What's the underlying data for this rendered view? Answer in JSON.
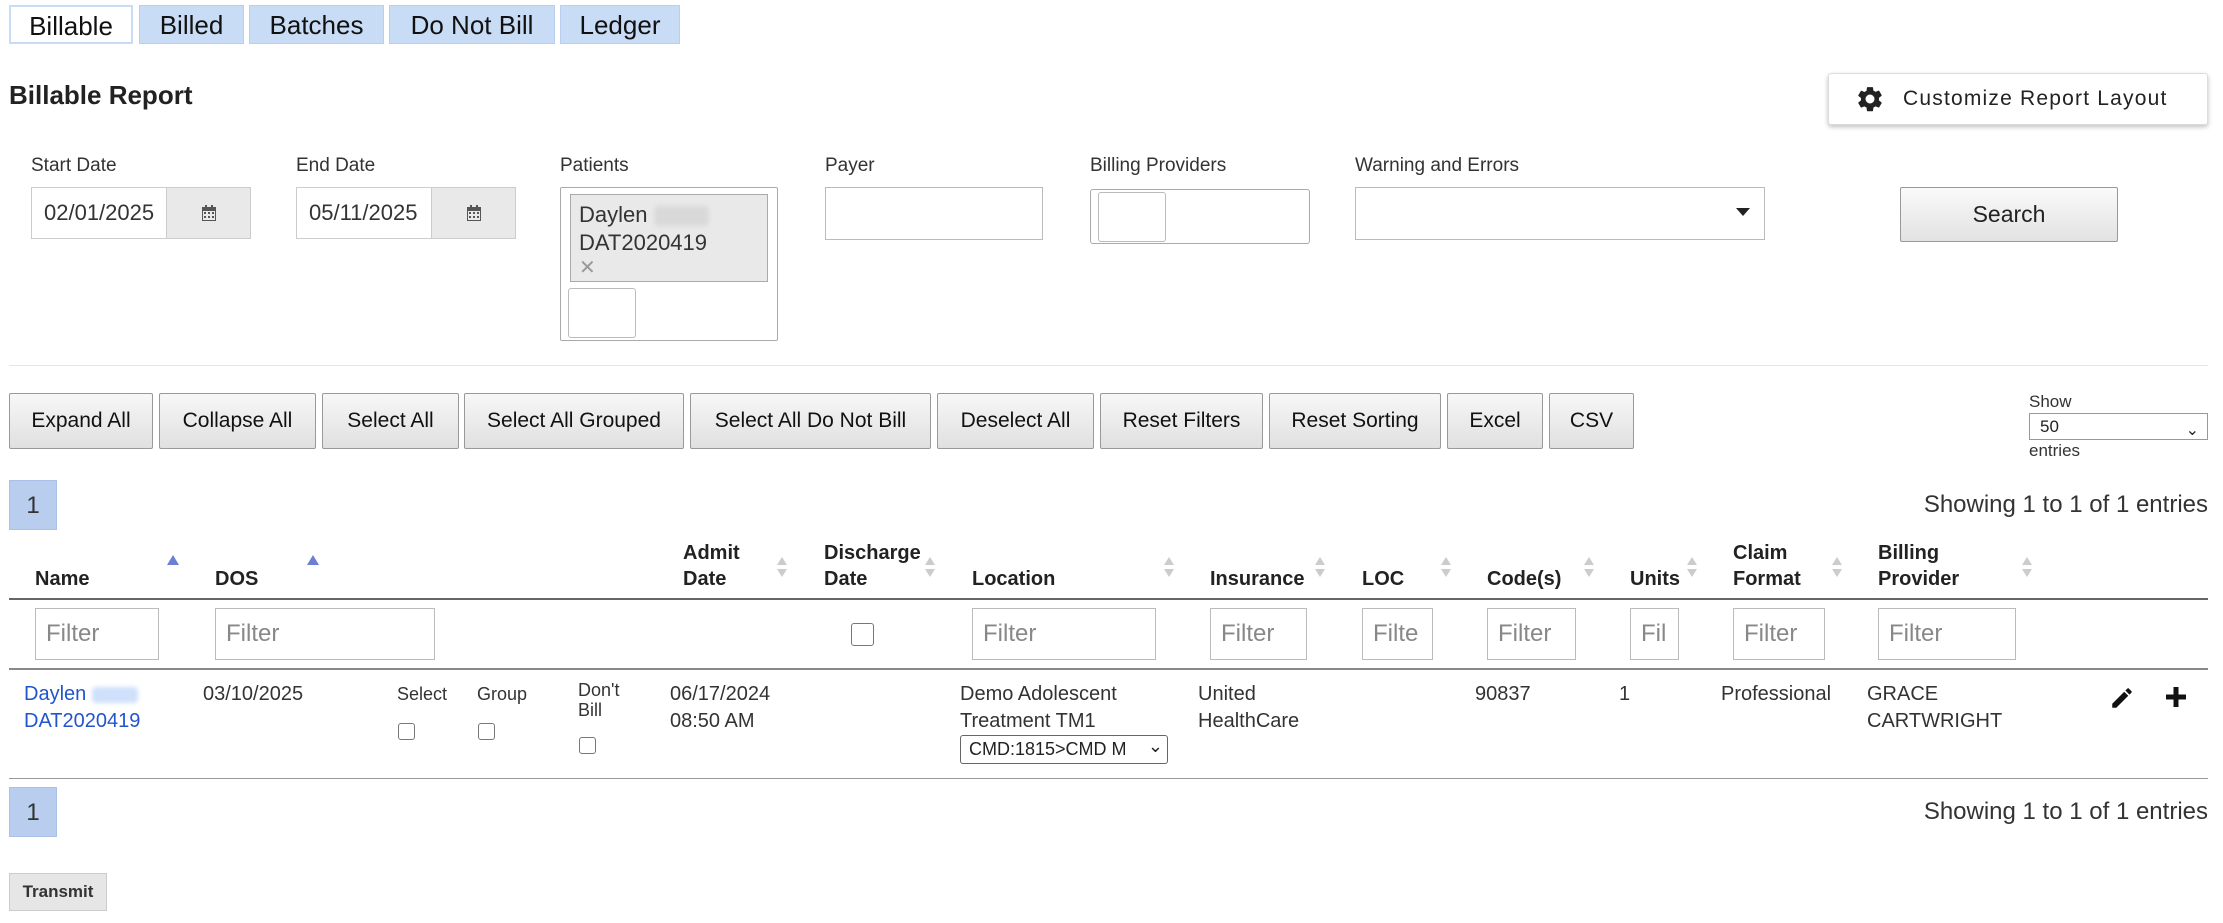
{
  "tabs": [
    {
      "label": "Billable",
      "active": true
    },
    {
      "label": "Billed"
    },
    {
      "label": "Batches"
    },
    {
      "label": "Do Not Bill"
    },
    {
      "label": "Ledger"
    }
  ],
  "page_title": "Billable Report",
  "customize_label": "Customize Report Layout",
  "filters": {
    "start_date_label": "Start Date",
    "start_date_value": "02/01/2025",
    "end_date_label": "End Date",
    "end_date_value": "05/11/2025",
    "patients_label": "Patients",
    "patient_chip_first": "Daylen",
    "patient_chip_id": "DAT2020419",
    "payer_label": "Payer",
    "billing_providers_label": "Billing Providers",
    "warnings_label": "Warning and Errors",
    "search_label": "Search"
  },
  "actions": [
    "Expand All",
    "Collapse All",
    "Select All",
    "Select All Grouped",
    "Select All Do Not Bill",
    "Deselect All",
    "Reset Filters",
    "Reset Sorting",
    "Excel",
    "CSV"
  ],
  "show": {
    "label": "Show",
    "value": "50",
    "suffix": "entries"
  },
  "pagination": {
    "page": "1",
    "info": "Showing 1 to 1 of 1 entries"
  },
  "table": {
    "headers": {
      "name": "Name",
      "dos": "DOS",
      "admit_1": "Admit",
      "admit_2": "Date",
      "discharge_1": "Discharge",
      "discharge_2": "Date",
      "location": "Location",
      "insurance": "Insurance",
      "loc": "LOC",
      "codes": "Code(s)",
      "units": "Units",
      "claim_1": "Claim",
      "claim_2": "Format",
      "provider_1": "Billing",
      "provider_2": "Provider"
    },
    "filter_placeholders": {
      "full": "Filter",
      "loc": "Filte",
      "units": "Fil"
    },
    "row": {
      "name_first": "Daylen",
      "name_id": "DAT2020419",
      "dos": "03/10/2025",
      "select_label": "Select",
      "group_label": "Group",
      "dont_bill_1": "Don't",
      "dont_bill_2": "Bill",
      "admit_date": "06/17/2024",
      "admit_time": "08:50 AM",
      "location_1": "Demo Adolescent",
      "location_2": "Treatment TM1",
      "location_select": "CMD:1815>CMD M",
      "insurance_1": "United",
      "insurance_2": "HealthCare",
      "codes": "90837",
      "units": "1",
      "claim_format": "Professional",
      "provider_1": "GRACE",
      "provider_2": "CARTWRIGHT"
    }
  },
  "transmit_label": "Transmit"
}
